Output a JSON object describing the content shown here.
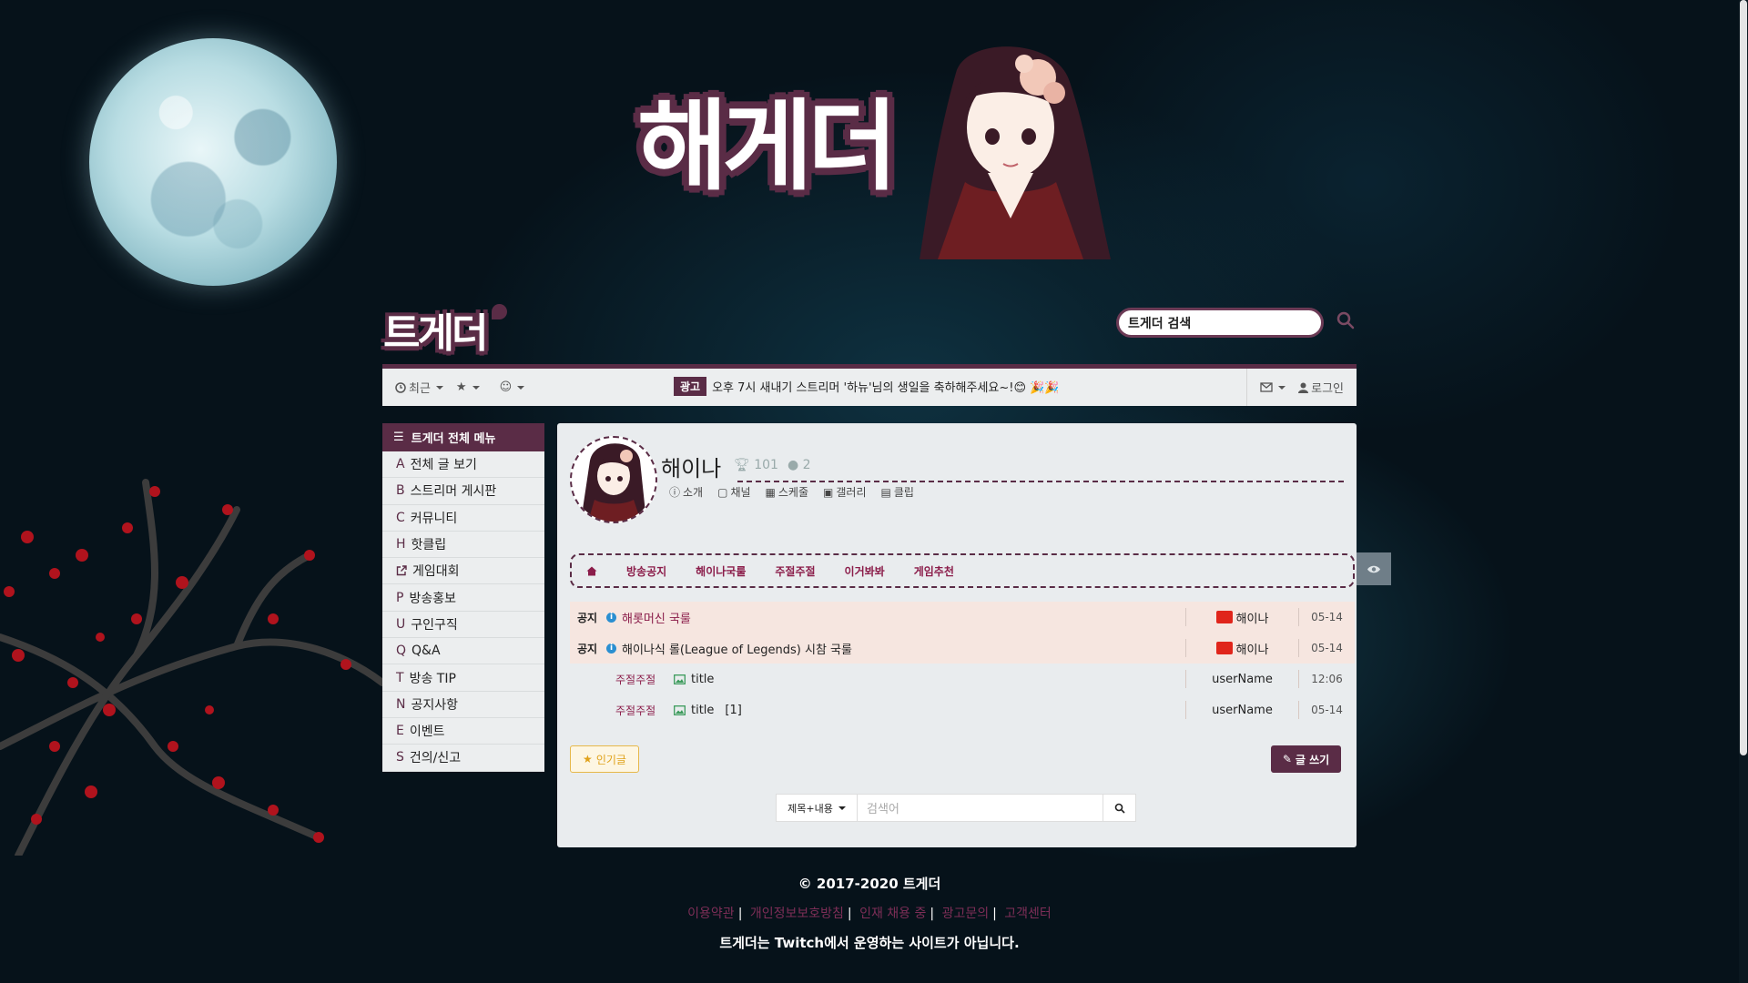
{
  "banner": {
    "title": "해게더"
  },
  "logo": {
    "text": "트게더"
  },
  "top_search": {
    "placeholder": "트게더 검색"
  },
  "topbar": {
    "recent_label": "최근",
    "ad_badge": "광고",
    "ad_text": "오후 7시 새내기 스트리머 '하뉴'님의 생일을 축하해주세요~!😊 🎉🎉",
    "login_label": "로그인"
  },
  "sidebar": {
    "header": "트게더 전체 메뉴",
    "items": [
      {
        "letter": "A",
        "label": "전체 글 보기"
      },
      {
        "letter": "B",
        "label": "스트리머 게시판"
      },
      {
        "letter": "C",
        "label": "커뮤니티"
      },
      {
        "letter": "H",
        "label": "핫클립"
      },
      {
        "letter": "",
        "label": "게임대회"
      },
      {
        "letter": "P",
        "label": "방송홍보"
      },
      {
        "letter": "U",
        "label": "구인구직"
      },
      {
        "letter": "Q",
        "label": "Q&A"
      },
      {
        "letter": "T",
        "label": "방송 TIP"
      },
      {
        "letter": "N",
        "label": "공지사항"
      },
      {
        "letter": "E",
        "label": "이벤트"
      },
      {
        "letter": "S",
        "label": "건의/신고"
      }
    ]
  },
  "channel": {
    "name": "해이나",
    "trophies": "101",
    "members": "2",
    "links": [
      "소개",
      "채널",
      "스케줄",
      "갤러리",
      "클립"
    ]
  },
  "tabs": [
    "방송공지",
    "해이나국룰",
    "주절주절",
    "이거봐봐",
    "게임추천"
  ],
  "posts": [
    {
      "tag": "공지",
      "category": "",
      "title": "해롯머신 국룰",
      "author": "해이나",
      "date": "05-14",
      "notice": true,
      "title_color": "#8b1d4a"
    },
    {
      "tag": "공지",
      "category": "",
      "title": "해이나식 롤(League of Legends) 시참 국룰",
      "author": "해이나",
      "date": "05-14",
      "notice": true,
      "title_color": "#222222"
    },
    {
      "tag": "",
      "category": "주절주절",
      "title": "title",
      "comments": "",
      "author": "userName",
      "date": "12:06",
      "notice": false
    },
    {
      "tag": "",
      "category": "주절주절",
      "title": "title",
      "comments": "[1]",
      "author": "userName",
      "date": "05-14",
      "notice": false
    }
  ],
  "buttons": {
    "popular": "인기글",
    "write": "글 쓰기"
  },
  "bottom_search": {
    "select": "제목+내용",
    "placeholder": "검색어"
  },
  "footer": {
    "copyright": "© 2017-2020 트게더",
    "links": [
      "이용약관",
      "개인정보보호방침",
      "인재 채용 중",
      "광고문의",
      "고객센터"
    ],
    "note": "트게더는 Twitch에서 운영하는 사이트가 아닙니다."
  },
  "colors": {
    "brand": "#5a2c46",
    "accent": "#8b1d4a",
    "link": "#7d2e57"
  }
}
